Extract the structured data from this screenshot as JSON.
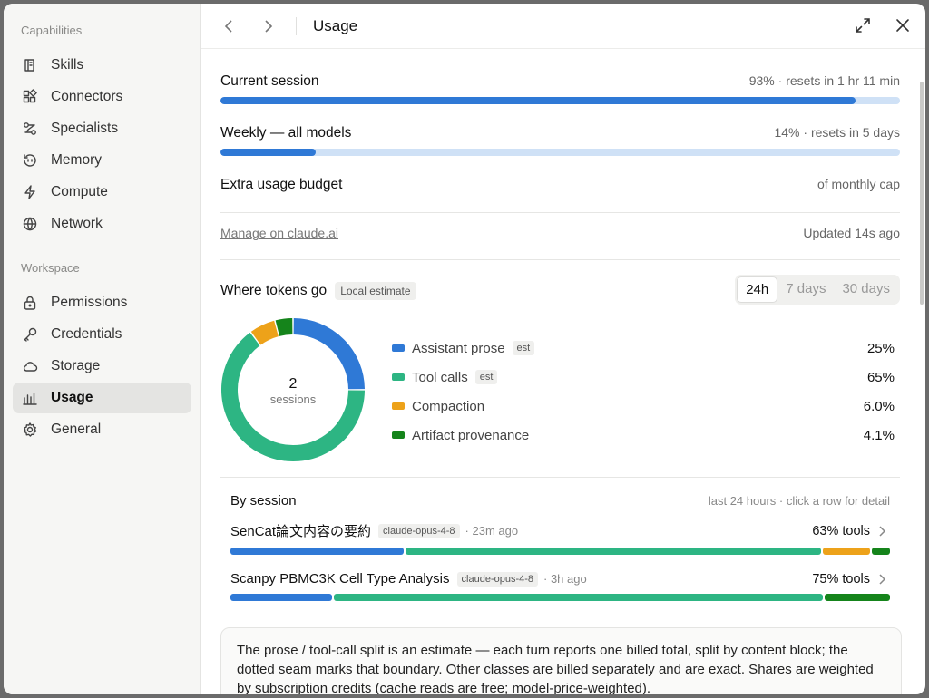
{
  "sidebar": {
    "capabilities_title": "Capabilities",
    "workspace_title": "Workspace",
    "capabilities": [
      {
        "label": "Skills",
        "icon": "skills-icon"
      },
      {
        "label": "Connectors",
        "icon": "connectors-icon"
      },
      {
        "label": "Specialists",
        "icon": "specialists-icon"
      },
      {
        "label": "Memory",
        "icon": "memory-icon"
      },
      {
        "label": "Compute",
        "icon": "compute-icon"
      },
      {
        "label": "Network",
        "icon": "network-icon"
      }
    ],
    "workspace": [
      {
        "label": "Permissions",
        "icon": "lock-icon"
      },
      {
        "label": "Credentials",
        "icon": "key-icon"
      },
      {
        "label": "Storage",
        "icon": "cloud-icon"
      },
      {
        "label": "Usage",
        "icon": "bar-chart-icon",
        "active": true
      },
      {
        "label": "General",
        "icon": "gear-icon"
      }
    ]
  },
  "header": {
    "title": "Usage"
  },
  "limits": {
    "current": {
      "label": "Current session",
      "meta": "93% · resets in 1 hr 11 min",
      "fraction": 0.934
    },
    "weekly": {
      "label": "Weekly — all models",
      "meta": "14% · resets in 5 days",
      "fraction": 0.14
    },
    "extra": {
      "label": "Extra usage budget",
      "meta": "of monthly cap"
    }
  },
  "manage": {
    "link": "Manage on claude.ai",
    "updated": "Updated 14s ago"
  },
  "tokens": {
    "title": "Where tokens go",
    "badge": "Local estimate",
    "ranges": [
      "24h",
      "7 days",
      "30 days"
    ],
    "active_range": "24h",
    "center_value": "2",
    "center_label": "sessions"
  },
  "chart_data": {
    "type": "pie",
    "title": "Where tokens go",
    "labels": [
      "Assistant prose",
      "Tool calls",
      "Compaction",
      "Artifact provenance"
    ],
    "values": [
      25,
      65,
      6.0,
      4.1
    ],
    "display": [
      "25%",
      "65%",
      "6.0%",
      "4.1%"
    ],
    "est": [
      "est",
      "est",
      "",
      ""
    ],
    "colors": [
      "#2f79d6",
      "#2db583",
      "#eda21a",
      "#15841b"
    ]
  },
  "sessions": {
    "title": "By session",
    "hint": "last 24 hours · click a row for detail",
    "rows": [
      {
        "name": "SenCat論文内容の要約",
        "model": "claude-opus-4-8",
        "ago": "· 23m ago",
        "tools": "63% tools",
        "split": [
          26.5,
          63.5,
          7.2,
          2.8
        ]
      },
      {
        "name": "Scanpy PBMC3K Cell Type Analysis",
        "model": "claude-opus-4-8",
        "ago": "· 3h ago",
        "tools": "75% tools",
        "split": [
          15.5,
          74.5,
          0,
          10
        ]
      }
    ]
  },
  "note": "The prose / tool-call split is an estimate — each turn reports one billed total, split by content block; the dotted seam marks that boundary. Other classes are billed separately and are exact. Shares are weighted by subscription credits (cache reads are free; model-price-weighted)."
}
